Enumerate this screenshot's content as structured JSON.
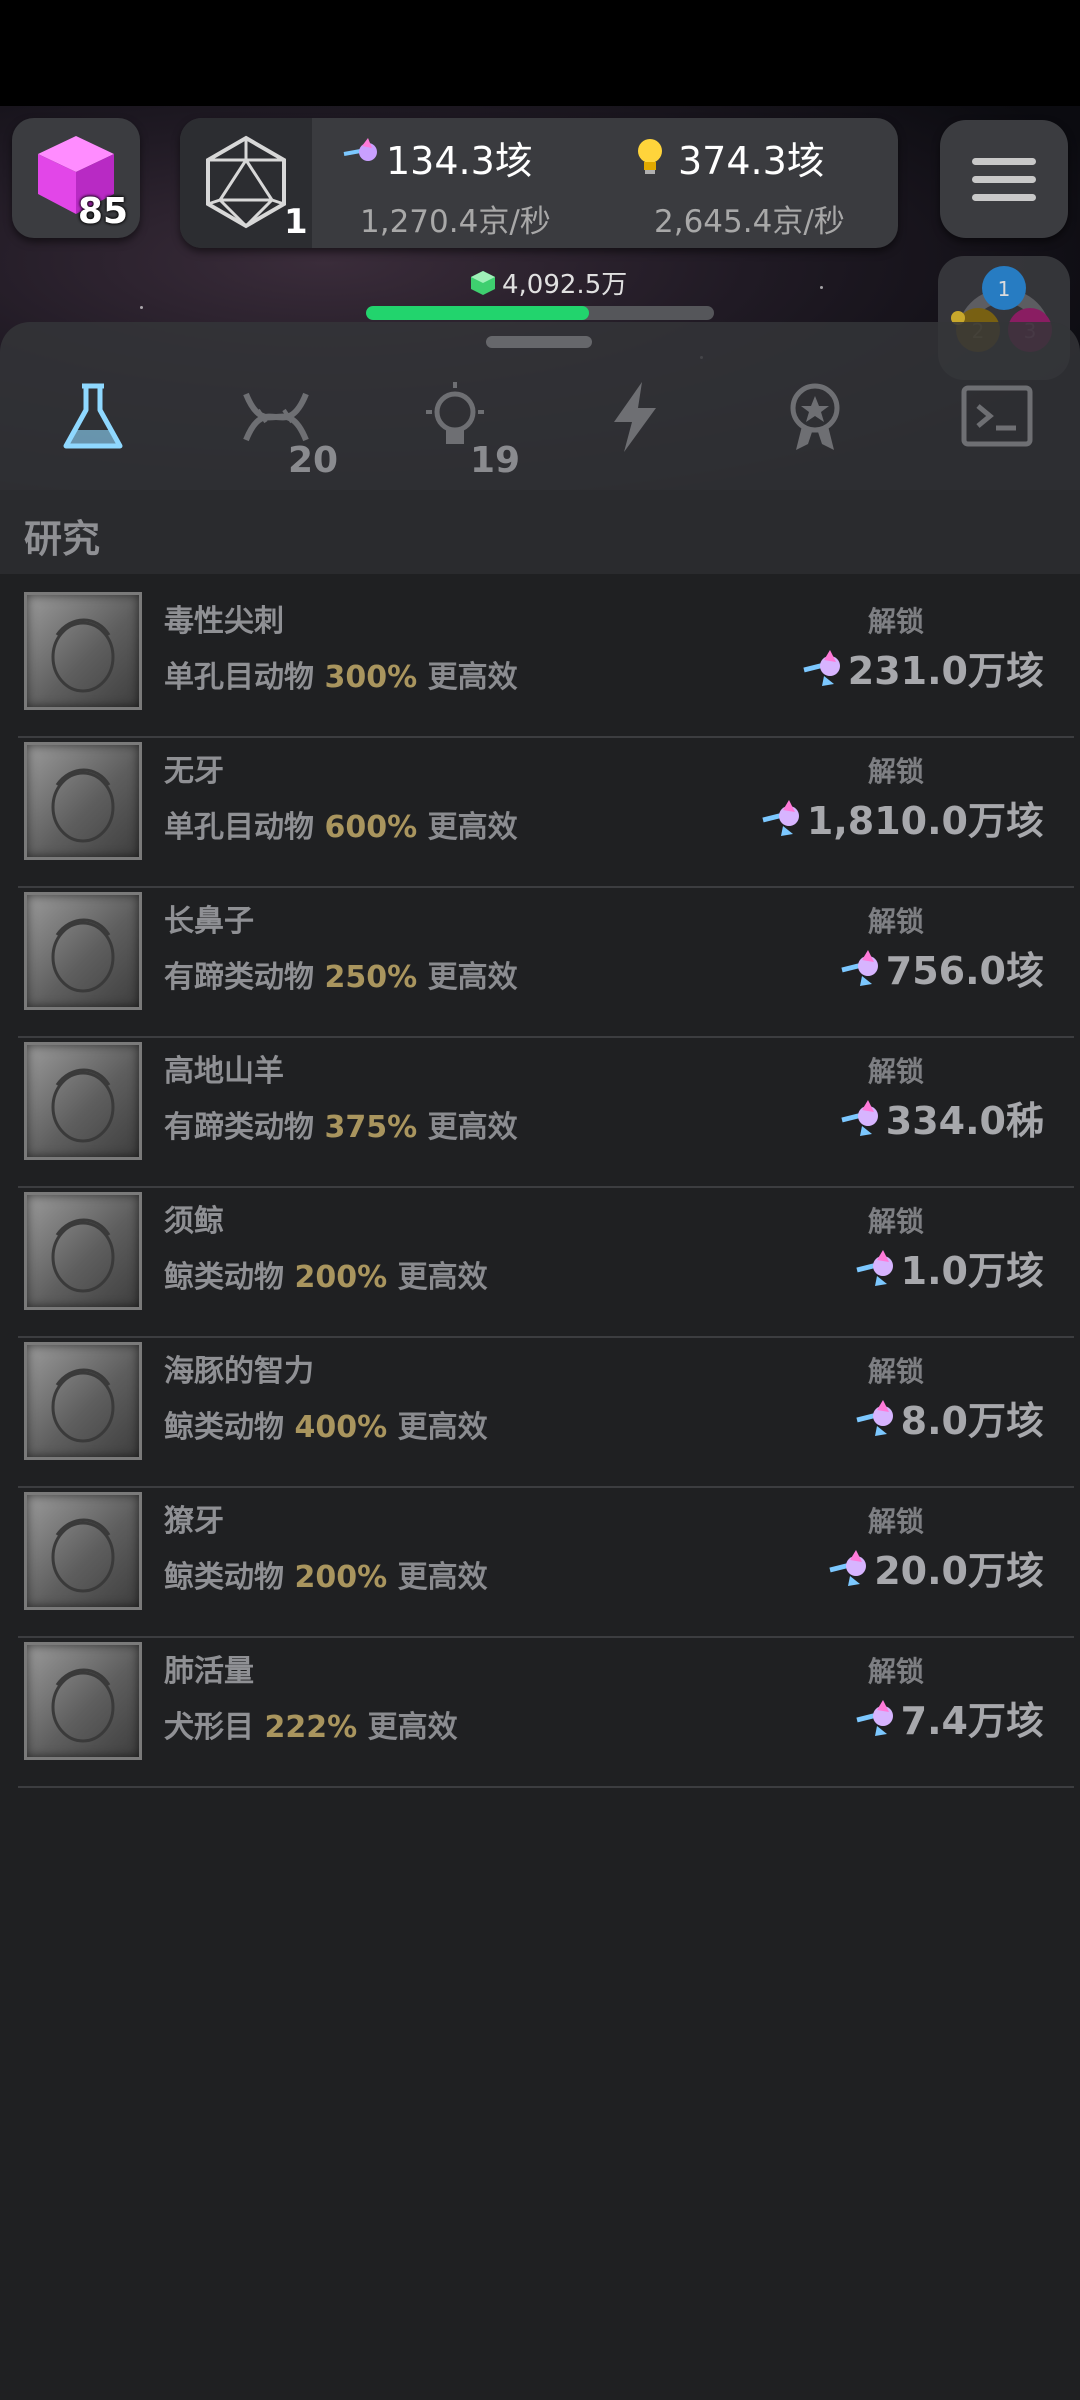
{
  "gems": {
    "count": "85"
  },
  "dice": {
    "count": "1"
  },
  "resources": {
    "primary": {
      "value": "134.3垓",
      "rate": "1,270.4京/秒",
      "icon": "crystal-wand-icon"
    },
    "secondary": {
      "value": "374.3垓",
      "rate": "2,645.4京/秒",
      "icon": "lightbulb-icon"
    }
  },
  "progress": {
    "label": "4,092.5万",
    "fraction": 0.64
  },
  "tabs": [
    {
      "icon": "flask-icon",
      "badge": "",
      "active": true
    },
    {
      "icon": "dna-icon",
      "badge": "20",
      "active": false
    },
    {
      "icon": "lightbulb-icon",
      "badge": "19",
      "active": false
    },
    {
      "icon": "lightning-icon",
      "badge": "",
      "active": false
    },
    {
      "icon": "award-icon",
      "badge": "",
      "active": false
    },
    {
      "icon": "terminal-icon",
      "badge": "",
      "active": false
    }
  ],
  "venn": {
    "labels": [
      "1",
      "2",
      "3"
    ]
  },
  "section": {
    "title": "研究"
  },
  "research": [
    {
      "name": "毒性尖刺",
      "category": "单孔目动物",
      "percent": "300%",
      "effect": "更高效",
      "unlock": "解锁",
      "cost": "231.0万垓"
    },
    {
      "name": "无牙",
      "category": "单孔目动物",
      "percent": "600%",
      "effect": "更高效",
      "unlock": "解锁",
      "cost": "1,810.0万垓"
    },
    {
      "name": "长鼻子",
      "category": "有蹄类动物",
      "percent": "250%",
      "effect": "更高效",
      "unlock": "解锁",
      "cost": "756.0垓"
    },
    {
      "name": "高地山羊",
      "category": "有蹄类动物",
      "percent": "375%",
      "effect": "更高效",
      "unlock": "解锁",
      "cost": "334.0秭"
    },
    {
      "name": "须鲸",
      "category": "鲸类动物",
      "percent": "200%",
      "effect": "更高效",
      "unlock": "解锁",
      "cost": "1.0万垓"
    },
    {
      "name": "海豚的智力",
      "category": "鲸类动物",
      "percent": "400%",
      "effect": "更高效",
      "unlock": "解锁",
      "cost": "8.0万垓"
    },
    {
      "name": "獠牙",
      "category": "鲸类动物",
      "percent": "200%",
      "effect": "更高效",
      "unlock": "解锁",
      "cost": "20.0万垓"
    },
    {
      "name": "肺活量",
      "category": "犬形目",
      "percent": "222%",
      "effect": "更高效",
      "unlock": "解锁",
      "cost": "7.4万垓"
    }
  ],
  "colors": {
    "accent": "#22d46d",
    "percent": "#a9955e",
    "active_tab": "#8fd8ff",
    "background": "#1f2022"
  }
}
